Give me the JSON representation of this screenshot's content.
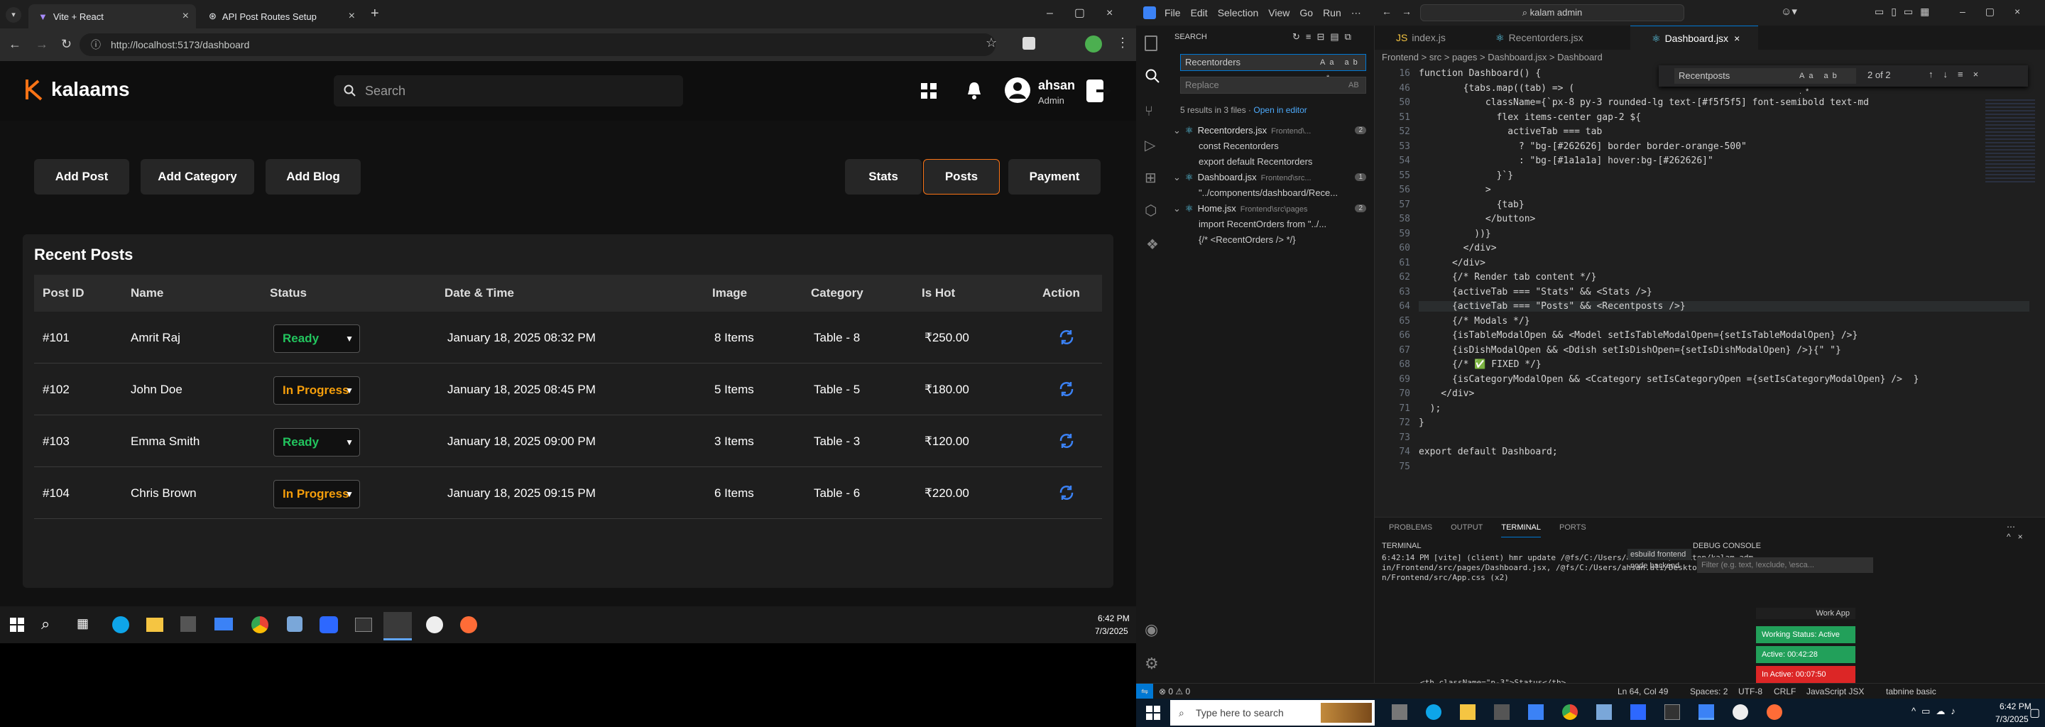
{
  "browser": {
    "tabs": [
      {
        "label": "Vite + React"
      },
      {
        "label": "API Post Routes Setup"
      }
    ],
    "url": "http://localhost:5173/dashboard"
  },
  "app": {
    "logo_text": "kalaams",
    "search_placeholder": "Search",
    "user": {
      "name": "ahsan",
      "role": "Admin"
    },
    "left_buttons": [
      "Add Post",
      "Add Category",
      "Add Blog"
    ],
    "right_tabs": [
      "Stats",
      "Posts",
      "Payment"
    ],
    "active_tab": "Posts",
    "accent": "#f97316",
    "panel_title": "Recent Posts",
    "columns": [
      "Post ID",
      "Name",
      "Status",
      "Date & Time",
      "Image",
      "Category",
      "Is Hot",
      "Action"
    ],
    "rows": [
      {
        "id": "#101",
        "name": "Amrit Raj",
        "status": "Ready",
        "date": "January 18, 2025 08:32 PM",
        "image": "8 Items",
        "category": "Table - 8",
        "hot": "₹250.00"
      },
      {
        "id": "#102",
        "name": "John Doe",
        "status": "In Progress",
        "date": "January 18, 2025 08:45 PM",
        "image": "5 Items",
        "category": "Table - 5",
        "hot": "₹180.00"
      },
      {
        "id": "#103",
        "name": "Emma Smith",
        "status": "Ready",
        "date": "January 18, 2025 09:00 PM",
        "image": "3 Items",
        "category": "Table - 3",
        "hot": "₹120.00"
      },
      {
        "id": "#104",
        "name": "Chris Brown",
        "status": "In Progress",
        "date": "January 18, 2025 09:15 PM",
        "image": "6 Items",
        "category": "Table - 6",
        "hot": "₹220.00"
      }
    ],
    "status_colors": {
      "Ready": "#22c55e",
      "In Progress": "#f59e0b"
    }
  },
  "taskbar_left": {
    "time": "6:42 PM",
    "date": "7/3/2025"
  },
  "vscode": {
    "menu": [
      "File",
      "Edit",
      "Selection",
      "View",
      "Go",
      "Run"
    ],
    "command_center": "kalam admin",
    "search": {
      "title": "SEARCH",
      "query": "Recentorders",
      "replace_placeholder": "Replace",
      "summary": "5 results in 3 files",
      "open_in_editor": "Open in editor",
      "results": [
        {
          "file": "Recentorders.jsx",
          "path": "Frontend\\...",
          "count": "2",
          "matches": [
            "const Recentorders",
            "export default Recentorders"
          ]
        },
        {
          "file": "Dashboard.jsx",
          "path": "Frontend\\src...",
          "count": "1",
          "matches": [
            "\"../components/dashboard/Rece..."
          ]
        },
        {
          "file": "Home.jsx",
          "path": "Frontend\\src\\pages",
          "count": "2",
          "matches": [
            "import RecentOrders from \"../...",
            "{/* <RecentOrders /> */}"
          ]
        }
      ]
    },
    "tabs": [
      "index.js",
      "Recentorders.jsx",
      "Dashboard.jsx"
    ],
    "breadcrumb": "Frontend > src > pages > Dashboard.jsx > Dashboard",
    "find": {
      "query": "Recentposts",
      "result": "2 of 2"
    },
    "code_lines": [
      {
        "n": "16",
        "t": "function Dashboard() {"
      },
      {
        "n": "46",
        "t": "        {tabs.map((tab) => ("
      },
      {
        "n": "50",
        "t": "            className={`px-8 py-3 rounded-lg text-[#f5f5f5] font-semibold text-md"
      },
      {
        "n": "51",
        "t": "              flex items-center gap-2 ${"
      },
      {
        "n": "52",
        "t": "                activeTab === tab"
      },
      {
        "n": "53",
        "t": "                  ? \"bg-[#262626] border border-orange-500\""
      },
      {
        "n": "54",
        "t": "                  : \"bg-[#1a1a1a] hover:bg-[#262626]\""
      },
      {
        "n": "55",
        "t": "              }`}"
      },
      {
        "n": "56",
        "t": "            >"
      },
      {
        "n": "57",
        "t": "              {tab}"
      },
      {
        "n": "58",
        "t": "            </button>"
      },
      {
        "n": "59",
        "t": "          ))}"
      },
      {
        "n": "60",
        "t": "        </div>"
      },
      {
        "n": "61",
        "t": "      </div>"
      },
      {
        "n": "62",
        "t": "      {/* Render tab content */}"
      },
      {
        "n": "63",
        "t": "      {activeTab === \"Stats\" && <Stats />}"
      },
      {
        "n": "64",
        "t": "      {activeTab === \"Posts\" && <Recentposts />}"
      },
      {
        "n": "65",
        "t": "      {/* Modals */}"
      },
      {
        "n": "66",
        "t": "      {isTableModalOpen && <Model setIsTableModalOpen={setIsTableModalOpen} />}"
      },
      {
        "n": "67",
        "t": "      {isDishModalOpen && <Ddish setIsDishOpen={setIsDishModalOpen} />}{\" \"}"
      },
      {
        "n": "68",
        "t": "      {/* ✅ FIXED */}"
      },
      {
        "n": "69",
        "t": "      {isCategoryModalOpen && <Ccategory setIsCategoryOpen ={setIsCategoryModalOpen} />  }"
      },
      {
        "n": "70",
        "t": "    </div>"
      },
      {
        "n": "71",
        "t": "  );"
      },
      {
        "n": "72",
        "t": "}"
      },
      {
        "n": "73",
        "t": ""
      },
      {
        "n": "74",
        "t": "export default Dashboard;"
      },
      {
        "n": "75",
        "t": ""
      }
    ],
    "panel_tabs": [
      "PROBLEMS",
      "OUTPUT",
      "TERMINAL",
      "PORTS"
    ],
    "terminal_title": "TERMINAL",
    "terminal_lines": [
      "6:42:14 PM [vite] (client) hmr update /@fs/C:/Users/ahsan.ali/Desktop/kalam adm",
      "in/Frontend/src/pages/Dashboard.jsx, /@fs/C:/Users/ahsan.ali/Desktop/kalam admi",
      "n/Frontend/src/App.css (x2)"
    ],
    "terminals": [
      "esbuild frontend",
      "node backend"
    ],
    "debug_console": "DEBUG CONSOLE",
    "debug_filter": "Filter (e.g. text, !exclude, \\esca...",
    "work_app": "Work App",
    "work_status": "Working Status: Active",
    "active_time": "Active: 00:42:28",
    "inactive_time": "In Active: 00:07:50",
    "status_bar": {
      "errors": "⊗ 0  ⚠ 0",
      "position": "Ln 64, Col 49",
      "spaces": "Spaces: 2",
      "encoding": "UTF-8",
      "eol": "CRLF",
      "language": "JavaScript JSX",
      "tabnine": "tabnine basic"
    },
    "peek_line": "<th className=\"p-3\">Status</th>"
  },
  "taskbar_right": {
    "search_placeholder": "Type here to search",
    "time": "6:42 PM",
    "date": "7/3/2025"
  }
}
